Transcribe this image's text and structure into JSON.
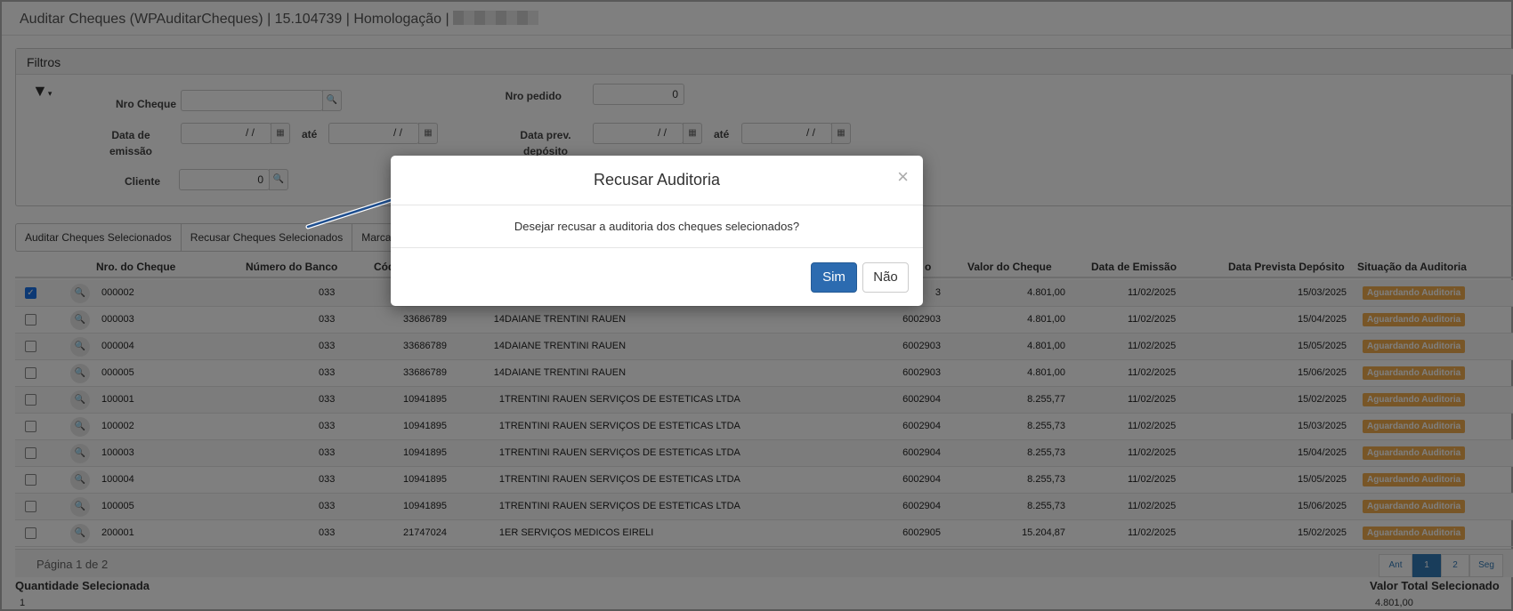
{
  "header": {
    "title": "Auditar Cheques (WPAuditarCheques) | 15.104739 | Homologação |"
  },
  "filters": {
    "title": "Filtros",
    "nro_cheque_label": "Nro Cheque",
    "nro_cheque_value": "",
    "nro_pedido_label": "Nro pedido",
    "nro_pedido_value": "0",
    "data_emissao_label_1": "Data de",
    "data_emissao_label_2": "emissão",
    "data_emissao_de": "/ /",
    "ate_label": "até",
    "data_emissao_ate": "/ /",
    "data_prev_label_1": "Data prev.",
    "data_prev_label_2": "depósito",
    "data_prev_de": "/ /",
    "data_prev_ate": "/ /",
    "cliente_label": "Cliente",
    "cliente_value": "0"
  },
  "tabs": [
    "Auditar Cheques Selecionados",
    "Recusar Cheques Selecionados",
    "Marca"
  ],
  "table": {
    "headers": {
      "nro_cheque": "Nro. do Cheque",
      "numero_banco": "Número do Banco",
      "cod": "Cód",
      "o": "o",
      "valor": "Valor do Cheque",
      "data_emissao": "Data de Emissão",
      "data_prevista": "Data Prevista Depósito",
      "situacao": "Situação da Auditoria"
    },
    "rows": [
      {
        "checked": true,
        "cheque": "000002",
        "banco": "033",
        "cod": "",
        "n": "",
        "cliente": "",
        "pedido": "3",
        "valor": "4.801,00",
        "emissao": "11/02/2025",
        "prevista": "15/03/2025",
        "situacao": "Aguardando Auditoria"
      },
      {
        "checked": false,
        "cheque": "000003",
        "banco": "033",
        "cod": "33686789",
        "n": "14",
        "cliente": "DAIANE TRENTINI RAUEN",
        "pedido": "6002903",
        "valor": "4.801,00",
        "emissao": "11/02/2025",
        "prevista": "15/04/2025",
        "situacao": "Aguardando Auditoria"
      },
      {
        "checked": false,
        "cheque": "000004",
        "banco": "033",
        "cod": "33686789",
        "n": "14",
        "cliente": "DAIANE TRENTINI RAUEN",
        "pedido": "6002903",
        "valor": "4.801,00",
        "emissao": "11/02/2025",
        "prevista": "15/05/2025",
        "situacao": "Aguardando Auditoria"
      },
      {
        "checked": false,
        "cheque": "000005",
        "banco": "033",
        "cod": "33686789",
        "n": "14",
        "cliente": "DAIANE TRENTINI RAUEN",
        "pedido": "6002903",
        "valor": "4.801,00",
        "emissao": "11/02/2025",
        "prevista": "15/06/2025",
        "situacao": "Aguardando Auditoria"
      },
      {
        "checked": false,
        "cheque": "100001",
        "banco": "033",
        "cod": "10941895",
        "n": "1",
        "cliente": "TRENTINI RAUEN SERVIÇOS DE ESTETICAS LTDA",
        "pedido": "6002904",
        "valor": "8.255,77",
        "emissao": "11/02/2025",
        "prevista": "15/02/2025",
        "situacao": "Aguardando Auditoria"
      },
      {
        "checked": false,
        "cheque": "100002",
        "banco": "033",
        "cod": "10941895",
        "n": "1",
        "cliente": "TRENTINI RAUEN SERVIÇOS DE ESTETICAS LTDA",
        "pedido": "6002904",
        "valor": "8.255,73",
        "emissao": "11/02/2025",
        "prevista": "15/03/2025",
        "situacao": "Aguardando Auditoria"
      },
      {
        "checked": false,
        "cheque": "100003",
        "banco": "033",
        "cod": "10941895",
        "n": "1",
        "cliente": "TRENTINI RAUEN SERVIÇOS DE ESTETICAS LTDA",
        "pedido": "6002904",
        "valor": "8.255,73",
        "emissao": "11/02/2025",
        "prevista": "15/04/2025",
        "situacao": "Aguardando Auditoria"
      },
      {
        "checked": false,
        "cheque": "100004",
        "banco": "033",
        "cod": "10941895",
        "n": "1",
        "cliente": "TRENTINI RAUEN SERVIÇOS DE ESTETICAS LTDA",
        "pedido": "6002904",
        "valor": "8.255,73",
        "emissao": "11/02/2025",
        "prevista": "15/05/2025",
        "situacao": "Aguardando Auditoria"
      },
      {
        "checked": false,
        "cheque": "100005",
        "banco": "033",
        "cod": "10941895",
        "n": "1",
        "cliente": "TRENTINI RAUEN SERVIÇOS DE ESTETICAS LTDA",
        "pedido": "6002904",
        "valor": "8.255,73",
        "emissao": "11/02/2025",
        "prevista": "15/06/2025",
        "situacao": "Aguardando Auditoria"
      },
      {
        "checked": false,
        "cheque": "200001",
        "banco": "033",
        "cod": "21747024",
        "n": "1",
        "cliente": "ER SERVIÇOS MEDICOS EIRELI",
        "pedido": "6002905",
        "valor": "15.204,87",
        "emissao": "11/02/2025",
        "prevista": "15/02/2025",
        "situacao": "Aguardando Auditoria"
      }
    ]
  },
  "pager": {
    "text": "Página 1 de 2",
    "prev": "Ant",
    "pages": [
      "1",
      "2"
    ],
    "next": "Seg"
  },
  "summary": {
    "qtd_label": "Quantidade Selecionada",
    "qtd_value": "1",
    "total_label": "Valor Total Selecionado",
    "total_value": "4.801,00"
  },
  "modal": {
    "title": "Recusar Auditoria",
    "close": "×",
    "message": "Desejar recusar a auditoria dos cheques selecionados?",
    "confirm": "Sim",
    "cancel": "Não"
  },
  "colors": {
    "primary": "#2c6bb0",
    "badge": "#f0ad4e",
    "arrow": "#1f4f8f"
  }
}
